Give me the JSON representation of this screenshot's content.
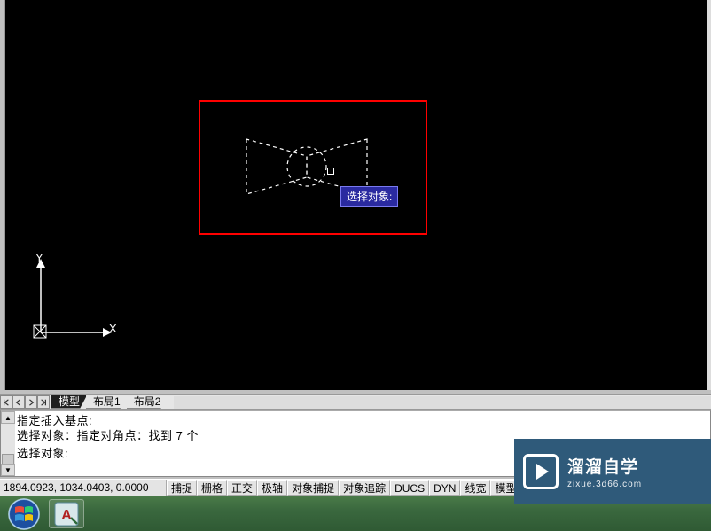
{
  "tooltip": "选择对象:",
  "ucs": {
    "x_label": "X",
    "y_label": "Y"
  },
  "tabs": {
    "model": "模型",
    "layout1": "布局1",
    "layout2": "布局2"
  },
  "command_lines": {
    "l1": "指定插入基点:",
    "l2": "选择对象：指定对角点：找到 7 个",
    "l3": "选择对象:"
  },
  "status": {
    "coords": "1894.0923, 1034.0403, 0.0000",
    "snap": "捕捉",
    "grid": "栅格",
    "ortho": "正交",
    "polar": "极轴",
    "osnap": "对象捕捉",
    "otrack": "对象追踪",
    "ducs": "DUCS",
    "dyn": "DYN",
    "lwt": "线宽",
    "modelbtn": "模型"
  },
  "watermark": {
    "title": "溜溜自学",
    "url": "zixue.3d66.com"
  }
}
